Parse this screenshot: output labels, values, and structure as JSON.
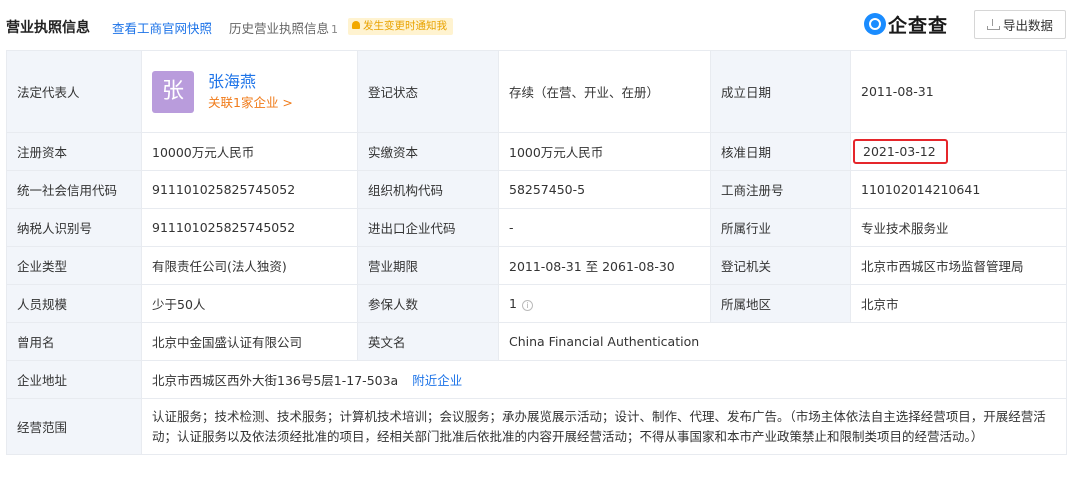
{
  "header": {
    "title": "营业执照信息",
    "link_snapshot": "查看工商官网快照",
    "history_label": "历史营业执照信息",
    "history_count": "1",
    "notify_badge": "发生变更时通知我",
    "logo_text": "企查查",
    "export_label": "导出数据"
  },
  "info": {
    "legal_rep": {
      "label": "法定代表人",
      "avatar_char": "张",
      "name": "张海燕",
      "related": "关联1家企业 >"
    },
    "reg_status": {
      "label": "登记状态",
      "value": "存续（在营、开业、在册）"
    },
    "est_date": {
      "label": "成立日期",
      "value": "2011-08-31"
    },
    "reg_capital": {
      "label": "注册资本",
      "value": "10000万元人民币"
    },
    "paid_capital": {
      "label": "实缴资本",
      "value": "1000万元人民币"
    },
    "approval_date": {
      "label": "核准日期",
      "value": "2021-03-12"
    },
    "credit_code": {
      "label": "统一社会信用代码",
      "value": "911101025825745052"
    },
    "org_code": {
      "label": "组织机构代码",
      "value": "58257450-5"
    },
    "reg_number": {
      "label": "工商注册号",
      "value": "110102014210641"
    },
    "taxpayer_id": {
      "label": "纳税人识别号",
      "value": "911101025825745052"
    },
    "import_export_code": {
      "label": "进出口企业代码",
      "value": "-"
    },
    "industry": {
      "label": "所属行业",
      "value": "专业技术服务业"
    },
    "company_type": {
      "label": "企业类型",
      "value": "有限责任公司(法人独资)"
    },
    "business_term": {
      "label": "营业期限",
      "value": "2011-08-31 至 2061-08-30"
    },
    "reg_authority": {
      "label": "登记机关",
      "value": "北京市西城区市场监督管理局"
    },
    "staff_size": {
      "label": "人员规模",
      "value": "少于50人"
    },
    "insured_count": {
      "label": "参保人数",
      "value": "1"
    },
    "region": {
      "label": "所属地区",
      "value": "北京市"
    },
    "former_name": {
      "label": "曾用名",
      "value": "北京中金国盛认证有限公司"
    },
    "english_name": {
      "label": "英文名",
      "value": "China Financial Authentication"
    },
    "address": {
      "label": "企业地址",
      "value": "北京市西城区西外大街136号5层1-17-503a",
      "link": "附近企业"
    },
    "scope": {
      "label": "经营范围",
      "value": "认证服务；技术检测、技术服务；计算机技术培训；会议服务；承办展览展示活动；设计、制作、代理、发布广告。（市场主体依法自主选择经营项目，开展经营活动；认证服务以及依法须经批准的项目，经相关部门批准后依批准的内容开展经营活动；不得从事国家和本市产业政策禁止和限制类项目的经营活动。）"
    }
  },
  "colors": {
    "link_blue": "#1e74e8",
    "related_orange": "#f07b1a",
    "highlight_red": "#e5262b",
    "label_bg": "#f2f5fa",
    "avatar_bg": "#b99cdc"
  }
}
